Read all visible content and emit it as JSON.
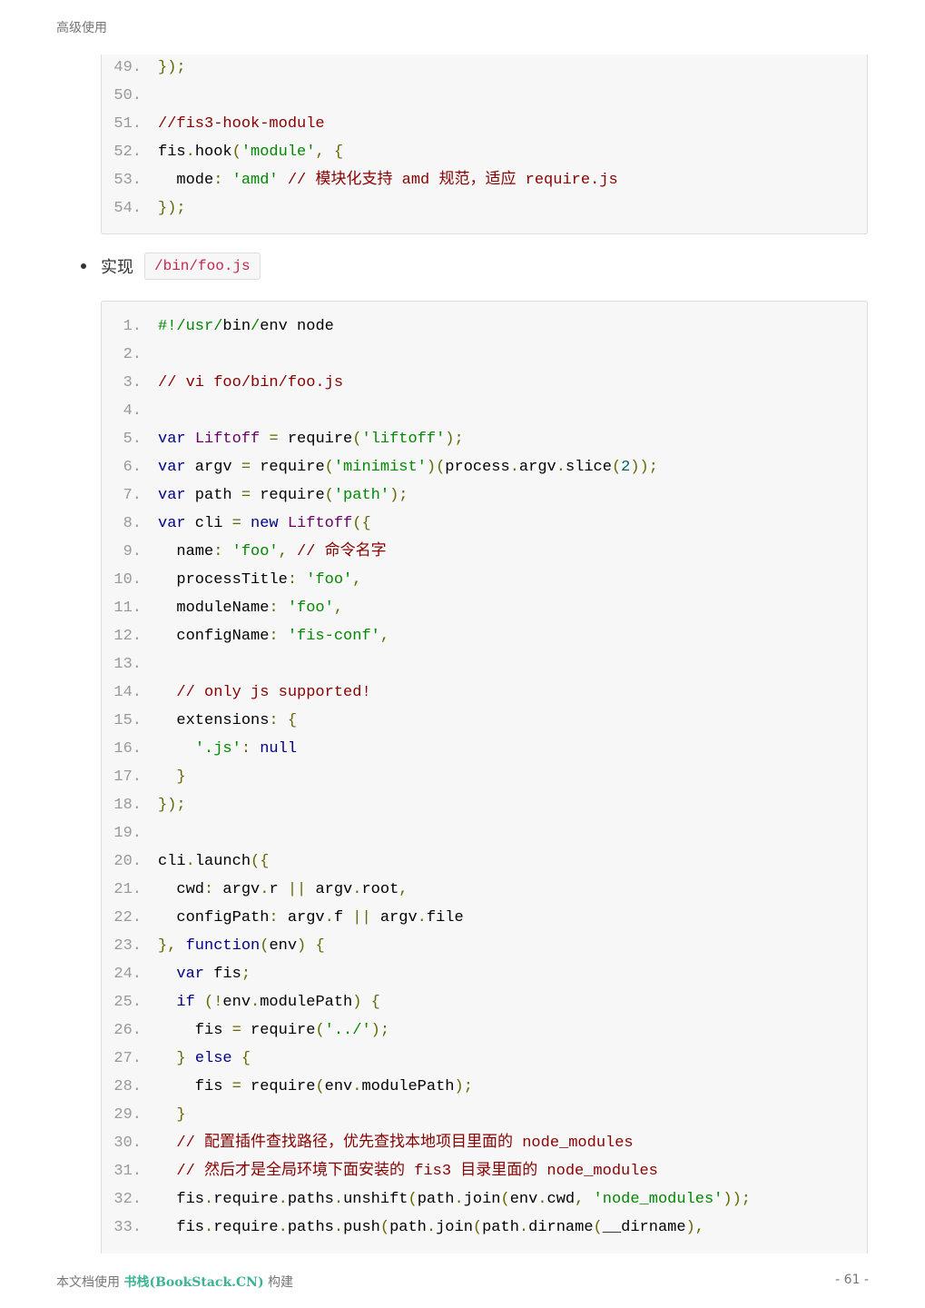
{
  "header": {
    "title": "高级使用"
  },
  "code_block_1": [
    {
      "n": "49.",
      "tokens": [
        [
          "p",
          "});"
        ]
      ]
    },
    {
      "n": "50.",
      "tokens": []
    },
    {
      "n": "51.",
      "tokens": [
        [
          "c",
          "//fis3-hook-module"
        ]
      ]
    },
    {
      "n": "52.",
      "tokens": [
        [
          "x",
          "fis"
        ],
        [
          "p",
          "."
        ],
        [
          "x",
          "hook"
        ],
        [
          "p",
          "("
        ],
        [
          "s",
          "'module'"
        ],
        [
          "p",
          ", {"
        ]
      ]
    },
    {
      "n": "53.",
      "tokens": [
        [
          "x",
          "  mode"
        ],
        [
          "p",
          ": "
        ],
        [
          "s",
          "'amd'"
        ],
        [
          "x",
          " "
        ],
        [
          "c",
          "// 模块化支持 amd 规范，适应 require.js"
        ]
      ]
    },
    {
      "n": "54.",
      "tokens": [
        [
          "p",
          "});"
        ]
      ]
    }
  ],
  "bullet": {
    "label": "实现",
    "code": "/bin/foo.js"
  },
  "code_block_2": [
    {
      "n": "1.",
      "tokens": [
        [
          "s",
          "#!/usr/"
        ],
        [
          "x",
          "bin"
        ],
        [
          "s",
          "/"
        ],
        [
          "x",
          "env node"
        ]
      ]
    },
    {
      "n": "2.",
      "tokens": []
    },
    {
      "n": "3.",
      "tokens": [
        [
          "c",
          "// vi foo/bin/foo.js"
        ]
      ]
    },
    {
      "n": "4.",
      "tokens": []
    },
    {
      "n": "5.",
      "tokens": [
        [
          "k",
          "var"
        ],
        [
          "x",
          " "
        ],
        [
          "t",
          "Liftoff"
        ],
        [
          "x",
          " "
        ],
        [
          "p",
          "="
        ],
        [
          "x",
          " require"
        ],
        [
          "p",
          "("
        ],
        [
          "s",
          "'liftoff'"
        ],
        [
          "p",
          ");"
        ]
      ]
    },
    {
      "n": "6.",
      "tokens": [
        [
          "k",
          "var"
        ],
        [
          "x",
          " argv "
        ],
        [
          "p",
          "="
        ],
        [
          "x",
          " require"
        ],
        [
          "p",
          "("
        ],
        [
          "s",
          "'minimist'"
        ],
        [
          "p",
          ")("
        ],
        [
          "x",
          "process"
        ],
        [
          "p",
          "."
        ],
        [
          "x",
          "argv"
        ],
        [
          "p",
          "."
        ],
        [
          "x",
          "slice"
        ],
        [
          "p",
          "("
        ],
        [
          "n",
          "2"
        ],
        [
          "p",
          "));"
        ]
      ]
    },
    {
      "n": "7.",
      "tokens": [
        [
          "k",
          "var"
        ],
        [
          "x",
          " path "
        ],
        [
          "p",
          "="
        ],
        [
          "x",
          " require"
        ],
        [
          "p",
          "("
        ],
        [
          "s",
          "'path'"
        ],
        [
          "p",
          ");"
        ]
      ]
    },
    {
      "n": "8.",
      "tokens": [
        [
          "k",
          "var"
        ],
        [
          "x",
          " cli "
        ],
        [
          "p",
          "="
        ],
        [
          "x",
          " "
        ],
        [
          "k",
          "new"
        ],
        [
          "x",
          " "
        ],
        [
          "t",
          "Liftoff"
        ],
        [
          "p",
          "({"
        ]
      ]
    },
    {
      "n": "9.",
      "tokens": [
        [
          "x",
          "  name"
        ],
        [
          "p",
          ": "
        ],
        [
          "s",
          "'foo'"
        ],
        [
          "p",
          ","
        ],
        [
          "x",
          " "
        ],
        [
          "c",
          "// 命令名字"
        ]
      ]
    },
    {
      "n": "10.",
      "tokens": [
        [
          "x",
          "  processTitle"
        ],
        [
          "p",
          ": "
        ],
        [
          "s",
          "'foo'"
        ],
        [
          "p",
          ","
        ]
      ]
    },
    {
      "n": "11.",
      "tokens": [
        [
          "x",
          "  moduleName"
        ],
        [
          "p",
          ": "
        ],
        [
          "s",
          "'foo'"
        ],
        [
          "p",
          ","
        ]
      ]
    },
    {
      "n": "12.",
      "tokens": [
        [
          "x",
          "  configName"
        ],
        [
          "p",
          ": "
        ],
        [
          "s",
          "'fis-conf'"
        ],
        [
          "p",
          ","
        ]
      ]
    },
    {
      "n": "13.",
      "tokens": []
    },
    {
      "n": "14.",
      "tokens": [
        [
          "x",
          "  "
        ],
        [
          "c",
          "// only js supported!"
        ]
      ]
    },
    {
      "n": "15.",
      "tokens": [
        [
          "x",
          "  extensions"
        ],
        [
          "p",
          ": {"
        ]
      ]
    },
    {
      "n": "16.",
      "tokens": [
        [
          "x",
          "    "
        ],
        [
          "s",
          "'.js'"
        ],
        [
          "p",
          ": "
        ],
        [
          "k",
          "null"
        ]
      ]
    },
    {
      "n": "17.",
      "tokens": [
        [
          "x",
          "  "
        ],
        [
          "p",
          "}"
        ]
      ]
    },
    {
      "n": "18.",
      "tokens": [
        [
          "p",
          "});"
        ]
      ]
    },
    {
      "n": "19.",
      "tokens": []
    },
    {
      "n": "20.",
      "tokens": [
        [
          "x",
          "cli"
        ],
        [
          "p",
          "."
        ],
        [
          "x",
          "launch"
        ],
        [
          "p",
          "({"
        ]
      ]
    },
    {
      "n": "21.",
      "tokens": [
        [
          "x",
          "  cwd"
        ],
        [
          "p",
          ": "
        ],
        [
          "x",
          "argv"
        ],
        [
          "p",
          "."
        ],
        [
          "x",
          "r "
        ],
        [
          "p",
          "||"
        ],
        [
          "x",
          " argv"
        ],
        [
          "p",
          "."
        ],
        [
          "x",
          "root"
        ],
        [
          "p",
          ","
        ]
      ]
    },
    {
      "n": "22.",
      "tokens": [
        [
          "x",
          "  configPath"
        ],
        [
          "p",
          ": "
        ],
        [
          "x",
          "argv"
        ],
        [
          "p",
          "."
        ],
        [
          "x",
          "f "
        ],
        [
          "p",
          "||"
        ],
        [
          "x",
          " argv"
        ],
        [
          "p",
          "."
        ],
        [
          "x",
          "file"
        ]
      ]
    },
    {
      "n": "23.",
      "tokens": [
        [
          "p",
          "}, "
        ],
        [
          "k",
          "function"
        ],
        [
          "p",
          "("
        ],
        [
          "x",
          "env"
        ],
        [
          "p",
          ") {"
        ]
      ]
    },
    {
      "n": "24.",
      "tokens": [
        [
          "x",
          "  "
        ],
        [
          "k",
          "var"
        ],
        [
          "x",
          " fis"
        ],
        [
          "p",
          ";"
        ]
      ]
    },
    {
      "n": "25.",
      "tokens": [
        [
          "x",
          "  "
        ],
        [
          "k",
          "if"
        ],
        [
          "x",
          " "
        ],
        [
          "p",
          "(!"
        ],
        [
          "x",
          "env"
        ],
        [
          "p",
          "."
        ],
        [
          "x",
          "modulePath"
        ],
        [
          "p",
          ") {"
        ]
      ]
    },
    {
      "n": "26.",
      "tokens": [
        [
          "x",
          "    fis "
        ],
        [
          "p",
          "="
        ],
        [
          "x",
          " require"
        ],
        [
          "p",
          "("
        ],
        [
          "s",
          "'../'"
        ],
        [
          "p",
          ");"
        ]
      ]
    },
    {
      "n": "27.",
      "tokens": [
        [
          "x",
          "  "
        ],
        [
          "p",
          "}"
        ],
        [
          "x",
          " "
        ],
        [
          "k",
          "else"
        ],
        [
          "x",
          " "
        ],
        [
          "p",
          "{"
        ]
      ]
    },
    {
      "n": "28.",
      "tokens": [
        [
          "x",
          "    fis "
        ],
        [
          "p",
          "="
        ],
        [
          "x",
          " require"
        ],
        [
          "p",
          "("
        ],
        [
          "x",
          "env"
        ],
        [
          "p",
          "."
        ],
        [
          "x",
          "modulePath"
        ],
        [
          "p",
          ");"
        ]
      ]
    },
    {
      "n": "29.",
      "tokens": [
        [
          "x",
          "  "
        ],
        [
          "p",
          "}"
        ]
      ]
    },
    {
      "n": "30.",
      "tokens": [
        [
          "x",
          "  "
        ],
        [
          "c",
          "// 配置插件查找路径，优先查找本地项目里面的 node_modules"
        ]
      ]
    },
    {
      "n": "31.",
      "tokens": [
        [
          "x",
          "  "
        ],
        [
          "c",
          "// 然后才是全局环境下面安装的 fis3 目录里面的 node_modules"
        ]
      ]
    },
    {
      "n": "32.",
      "tokens": [
        [
          "x",
          "  fis"
        ],
        [
          "p",
          "."
        ],
        [
          "x",
          "require"
        ],
        [
          "p",
          "."
        ],
        [
          "x",
          "paths"
        ],
        [
          "p",
          "."
        ],
        [
          "x",
          "unshift"
        ],
        [
          "p",
          "("
        ],
        [
          "x",
          "path"
        ],
        [
          "p",
          "."
        ],
        [
          "x",
          "join"
        ],
        [
          "p",
          "("
        ],
        [
          "x",
          "env"
        ],
        [
          "p",
          "."
        ],
        [
          "x",
          "cwd"
        ],
        [
          "p",
          ", "
        ],
        [
          "s",
          "'node_modules'"
        ],
        [
          "p",
          "));"
        ]
      ]
    },
    {
      "n": "33.",
      "tokens": [
        [
          "x",
          "  fis"
        ],
        [
          "p",
          "."
        ],
        [
          "x",
          "require"
        ],
        [
          "p",
          "."
        ],
        [
          "x",
          "paths"
        ],
        [
          "p",
          "."
        ],
        [
          "x",
          "push"
        ],
        [
          "p",
          "("
        ],
        [
          "x",
          "path"
        ],
        [
          "p",
          "."
        ],
        [
          "x",
          "join"
        ],
        [
          "p",
          "("
        ],
        [
          "x",
          "path"
        ],
        [
          "p",
          "."
        ],
        [
          "x",
          "dirname"
        ],
        [
          "p",
          "("
        ],
        [
          "x",
          "__dirname"
        ],
        [
          "p",
          "),"
        ]
      ]
    }
  ],
  "footer": {
    "prefix": "本文档使用 ",
    "brand": "书栈(BookStack.CN)",
    "suffix": " 构建",
    "page": "- 61 -"
  },
  "colors": {
    "punctuation": "#666600",
    "string": "#008800",
    "comment": "#880000",
    "keyword": "#000088",
    "type": "#660066",
    "number": "#006666",
    "brand": "#3cb494"
  }
}
